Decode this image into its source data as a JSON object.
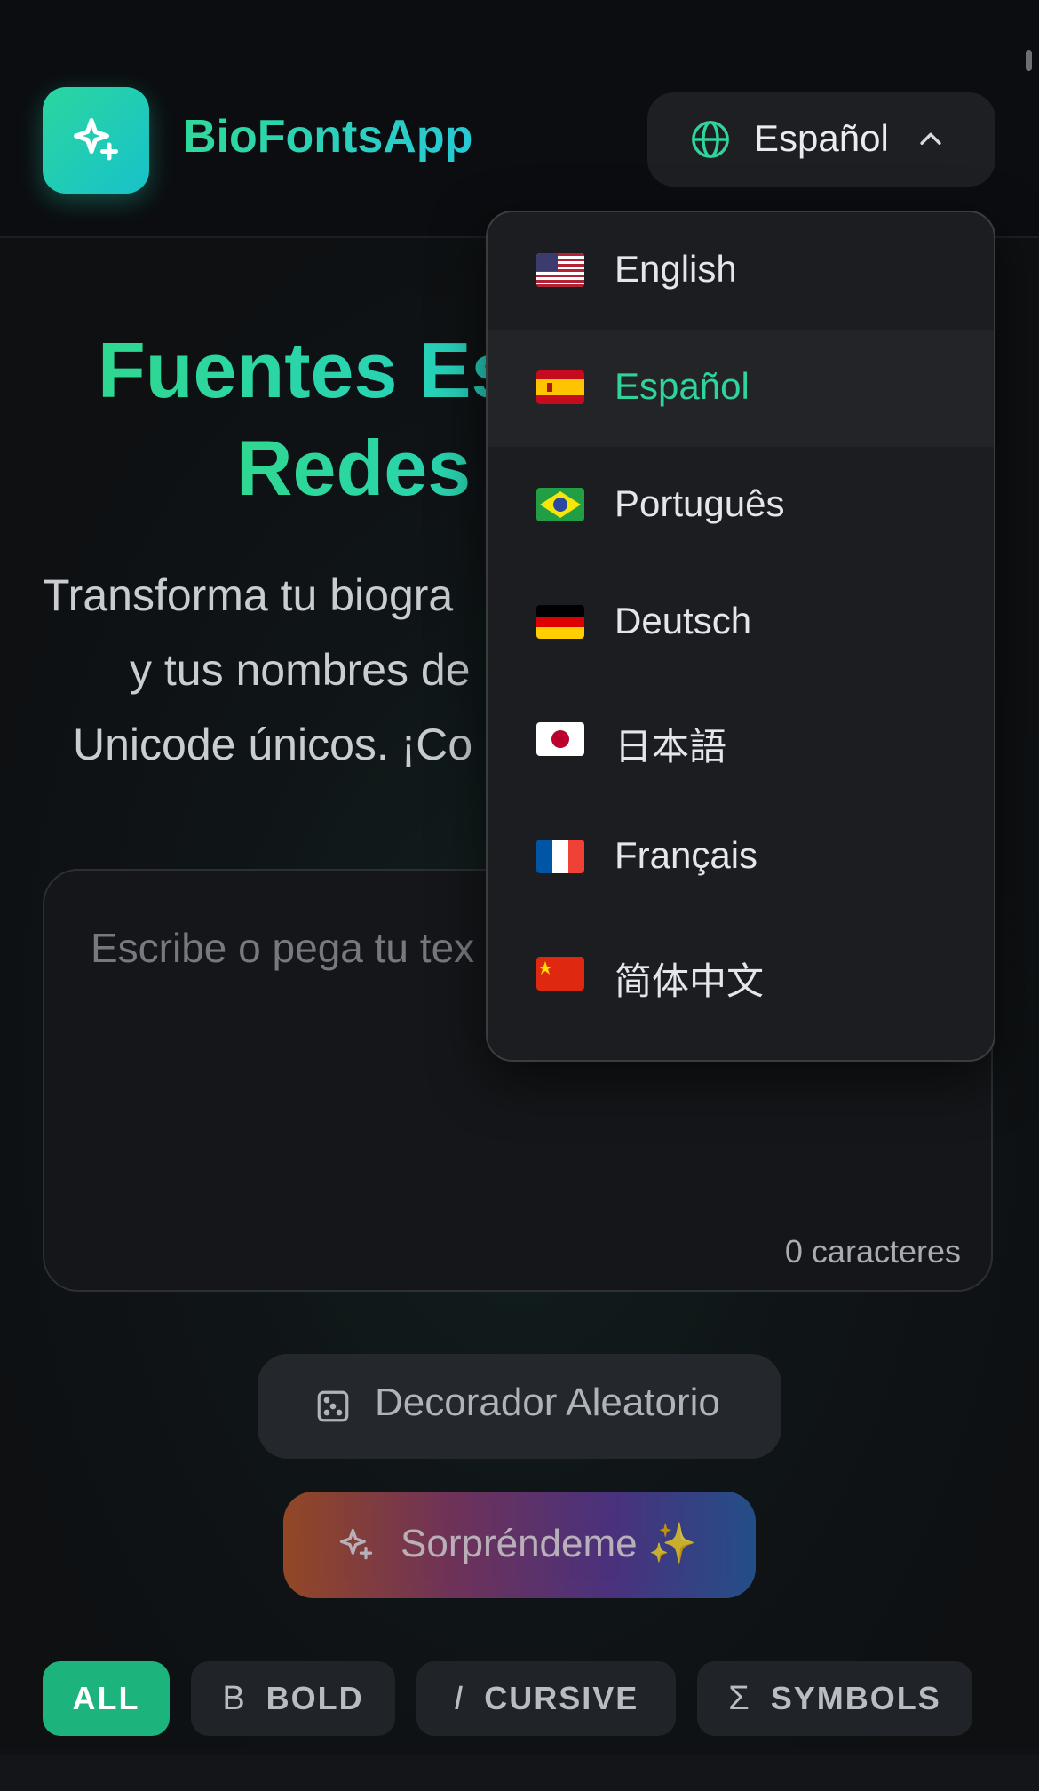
{
  "header": {
    "brand": "BioFontsApp",
    "language_button": {
      "label": "Español",
      "icon": "globe-icon",
      "chevron": "chevron-up-icon"
    }
  },
  "hero": {
    "title_line1": "Fuentes Es",
    "title_line2": "Redes",
    "subtitle_line1": "Transforma tu biogra",
    "subtitle_line2": "y tus nombres de",
    "subtitle_line3": "Unicode únicos. ¡Co"
  },
  "editor": {
    "placeholder": "Escribe o pega tu tex",
    "char_count": "0 caracteres"
  },
  "actions": {
    "decorator": "Decorador Aleatorio",
    "surprise": "Sorpréndeme ✨"
  },
  "filters": {
    "all": "ALL",
    "bold": "BOLD",
    "cursive": "CURSIVE",
    "symbols": "SYMBOLS",
    "active": "ALL"
  },
  "languages": {
    "selected": "Español",
    "items": [
      {
        "name": "English",
        "flag": "us"
      },
      {
        "name": "Español",
        "flag": "es"
      },
      {
        "name": "Português",
        "flag": "br"
      },
      {
        "name": "Deutsch",
        "flag": "de"
      },
      {
        "name": "日本語",
        "flag": "jp"
      },
      {
        "name": "Français",
        "flag": "fr"
      },
      {
        "name": "简体中文",
        "flag": "cn"
      }
    ]
  },
  "colors": {
    "accent": "#2fd49a",
    "background": "#0f1114"
  }
}
